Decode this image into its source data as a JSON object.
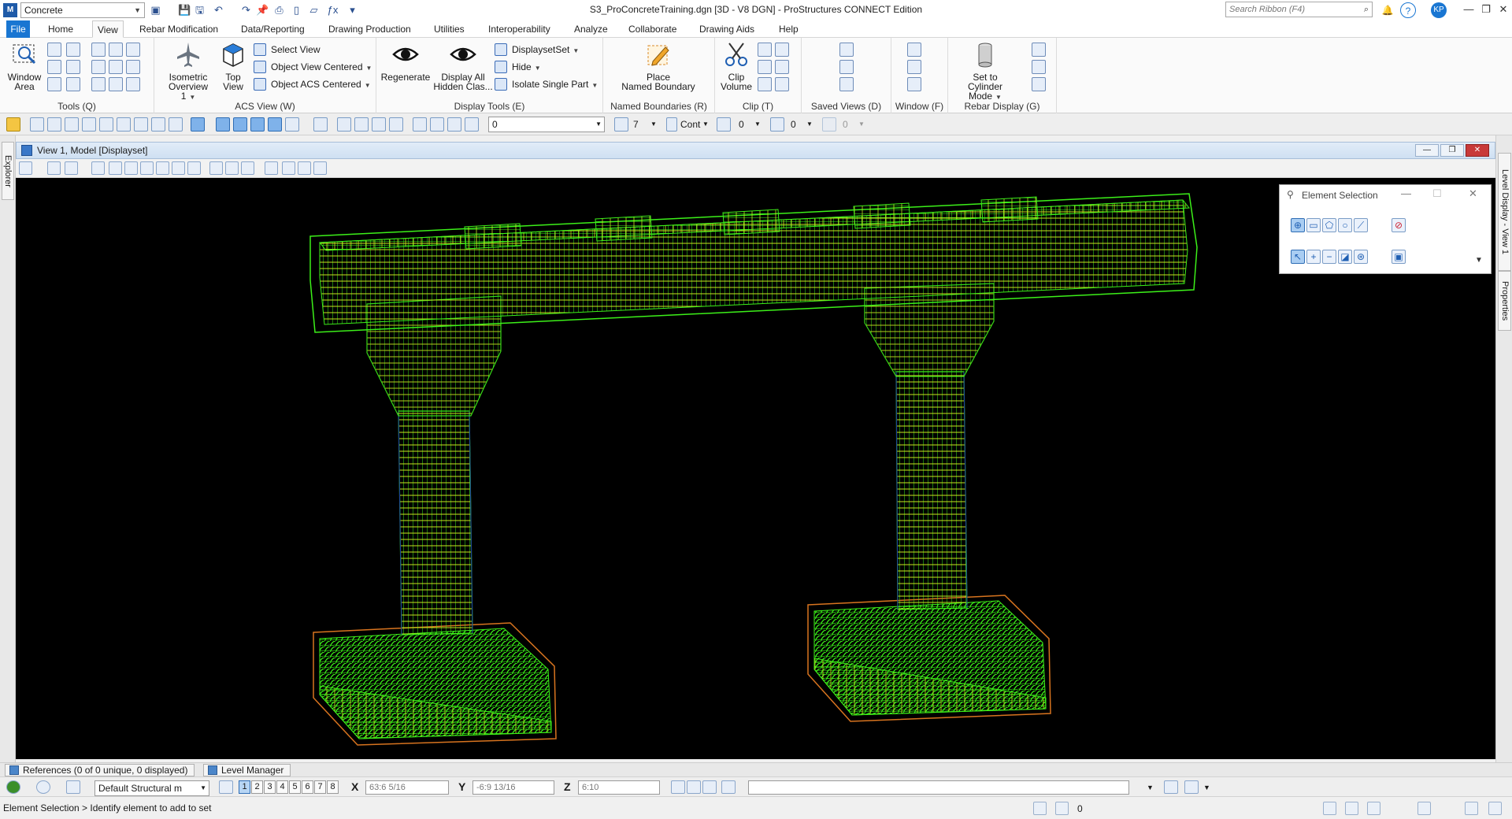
{
  "titlebar": {
    "workflow": "Concrete",
    "document_title": "S3_ProConcreteTraining.dgn [3D - V8 DGN] - ProStructures CONNECT Edition",
    "search_placeholder": "Search Ribbon (F4)",
    "user_initials": "KP"
  },
  "tabs": [
    "File",
    "Home",
    "View",
    "Rebar Modification",
    "Data/Reporting",
    "Drawing Production",
    "Utilities",
    "Interoperability",
    "Analyze",
    "Collaborate",
    "Drawing Aids",
    "Help"
  ],
  "active_tab": "View",
  "ribbon": {
    "tools": {
      "label": "Tools (Q)",
      "window_area": "Window\nArea"
    },
    "acs_view": {
      "label": "ACS View (W)",
      "isometric": "Isometric",
      "isometric2": "Overview 1",
      "top": "Top",
      "top2": "View",
      "select_view": "Select View",
      "object_view_centered": "Object View Centered",
      "object_acs_centered": "Object ACS Centered"
    },
    "display_tools": {
      "label": "Display Tools (E)",
      "regenerate": "Regenerate",
      "display_all": "Display All",
      "display_all2": "Hidden Clas...",
      "displayset": "DisplaysetSet",
      "hide": "Hide",
      "isolate": "Isolate Single Part"
    },
    "named_boundaries": {
      "label": "Named Boundaries (R)",
      "place": "Place",
      "place2": "Named Boundary"
    },
    "clip": {
      "label": "Clip (T)",
      "clip_volume": "Clip",
      "clip_volume2": "Volume"
    },
    "saved_views": {
      "label": "Saved Views (D)"
    },
    "window": {
      "label": "Window (F)"
    },
    "rebar_display": {
      "label": "Rebar Display (G)",
      "cylinder": "Set to",
      "cylinder2": "Cylinder Mode"
    }
  },
  "attributes": {
    "level": "0",
    "color": "7",
    "style": "Cont",
    "weight": "0",
    "transparency": "0",
    "priority": "0"
  },
  "view": {
    "title": "View 1, Model [Displayset]"
  },
  "left_rail": {
    "explorer": "Explorer"
  },
  "right_rail": {
    "level_display": "Level Display - View 1",
    "properties": "Properties"
  },
  "element_selection": {
    "title": "Element Selection"
  },
  "bottom_tabs": {
    "references": "References (0 of 0 unique, 0 displayed)",
    "level_manager": "Level Manager"
  },
  "coordbar": {
    "model": "Default Structural m",
    "views": [
      "1",
      "2",
      "3",
      "4",
      "5",
      "6",
      "7",
      "8"
    ],
    "x_label": "X",
    "x_value": "63:6 5/16",
    "y_label": "Y",
    "y_value": "-6:9 13/16",
    "z_label": "Z",
    "z_value": "6:10"
  },
  "status": {
    "prompt": "Element Selection > Identify element to add to set",
    "locks": "0"
  },
  "colors": {
    "rebar": "#3cf019",
    "rebar_highlight": "#c8e61e",
    "concrete_edge": "#d8741f",
    "accent": "#1976d2"
  }
}
